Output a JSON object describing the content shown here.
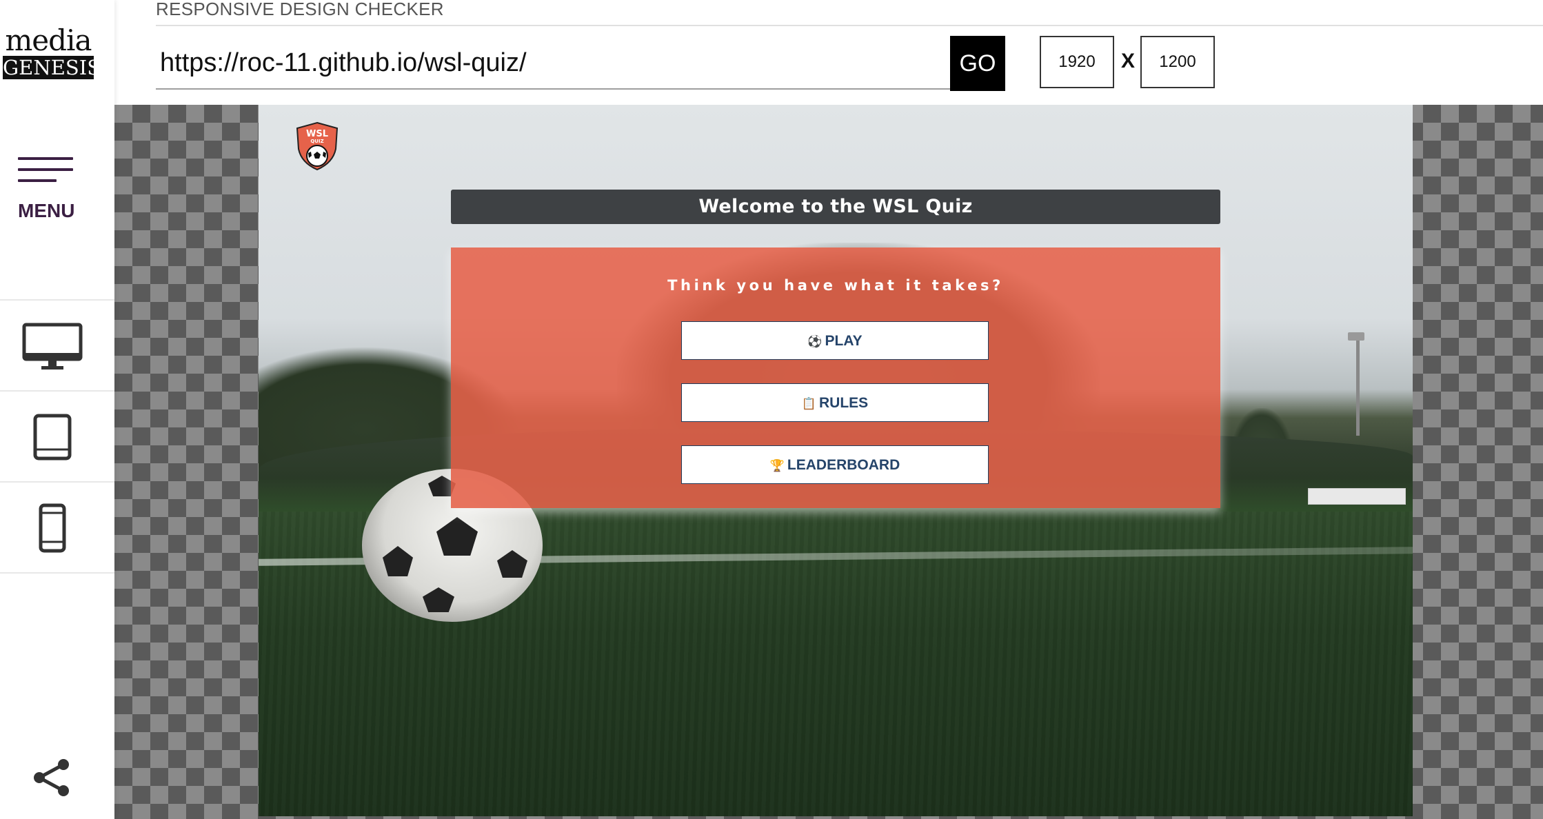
{
  "sidebar": {
    "logo_top": "media",
    "logo_bottom": "GENESIS",
    "menu_label": "MENU",
    "devices": [
      "desktop-icon",
      "tablet-icon",
      "phone-icon"
    ],
    "share_icon": "share-icon"
  },
  "header": {
    "title": "RESPONSIVE DESIGN CHECKER",
    "url": "https://roc-11.github.io/wsl-quiz/",
    "go_label": "GO",
    "width_value": "1920",
    "height_value": "1200",
    "separator": "X"
  },
  "site": {
    "logo_line1": "WSL",
    "logo_line2": "QUIZ",
    "welcome": "Welcome to the WSL Quiz",
    "tagline": "Think you have what it takes?",
    "buttons": {
      "play": "PLAY",
      "rules": "RULES",
      "leaderboard": "LEADERBOARD"
    },
    "colors": {
      "panel": "#e6624a",
      "welcome_bar": "#3e4144",
      "button_text": "#25446a",
      "menu": "#3b1f43"
    }
  }
}
